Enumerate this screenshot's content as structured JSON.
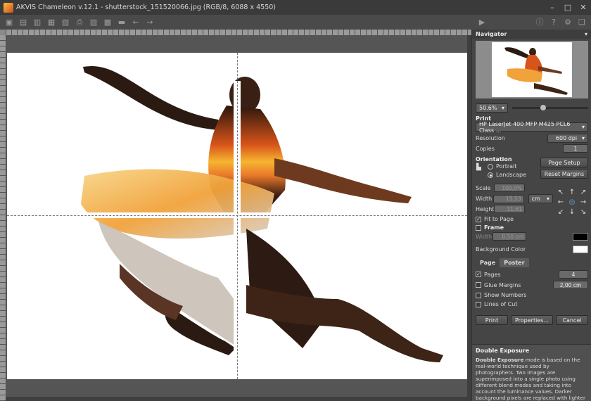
{
  "window": {
    "title": "AKVIS Chameleon v.12.1 - shutterstock_151520066.jpg (RGB/8, 6088 x 4550)"
  },
  "navigator": {
    "title": "Navigator",
    "zoom": "50.6%"
  },
  "print": {
    "title": "Print",
    "printer": "HP LaserJet 400 MFP M425 PCL6 Class ...",
    "resolution_label": "Resolution",
    "resolution_value": "600 dpi",
    "copies_label": "Copies",
    "copies_value": "1"
  },
  "orientation": {
    "title": "Orientation",
    "portrait": "Portrait",
    "landscape": "Landscape",
    "page_setup": "Page Setup",
    "reset_margins": "Reset Margins"
  },
  "scale": {
    "scale_label": "Scale",
    "scale_value": "100,0%",
    "width_label": "Width",
    "width_value": "15,53",
    "height_label": "Height",
    "height_value": "11,61",
    "unit": "cm"
  },
  "options": {
    "fit_to_page": "Fit to Page",
    "frame": "Frame",
    "frame_width_label": "Width",
    "frame_width_value": "0,50 cm",
    "background_color": "Background Color"
  },
  "tabs": {
    "page": "Page",
    "poster": "Poster"
  },
  "poster": {
    "pages_label": "Pages",
    "pages_value": "4",
    "glue_margins": "Glue Margins",
    "glue_value": "2,00 cm",
    "show_numbers": "Show Numbers",
    "lines_of_cut": "Lines of Cut"
  },
  "buttons": {
    "print": "Print",
    "properties": "Properties...",
    "cancel": "Cancel"
  },
  "help": {
    "title": "Double Exposure",
    "body_bold": "Double Exposure",
    "body": " mode is based on the real-world technique used by photographers. Two images are superimposed into a single photo using different blend modes and taking into account the luminance values. Darker background pixels are replaced with lighter pixels of a fragment, and darker pixels of a fragment"
  },
  "colors": {
    "frame_color": "#000000",
    "background_color": "#ffffff"
  }
}
